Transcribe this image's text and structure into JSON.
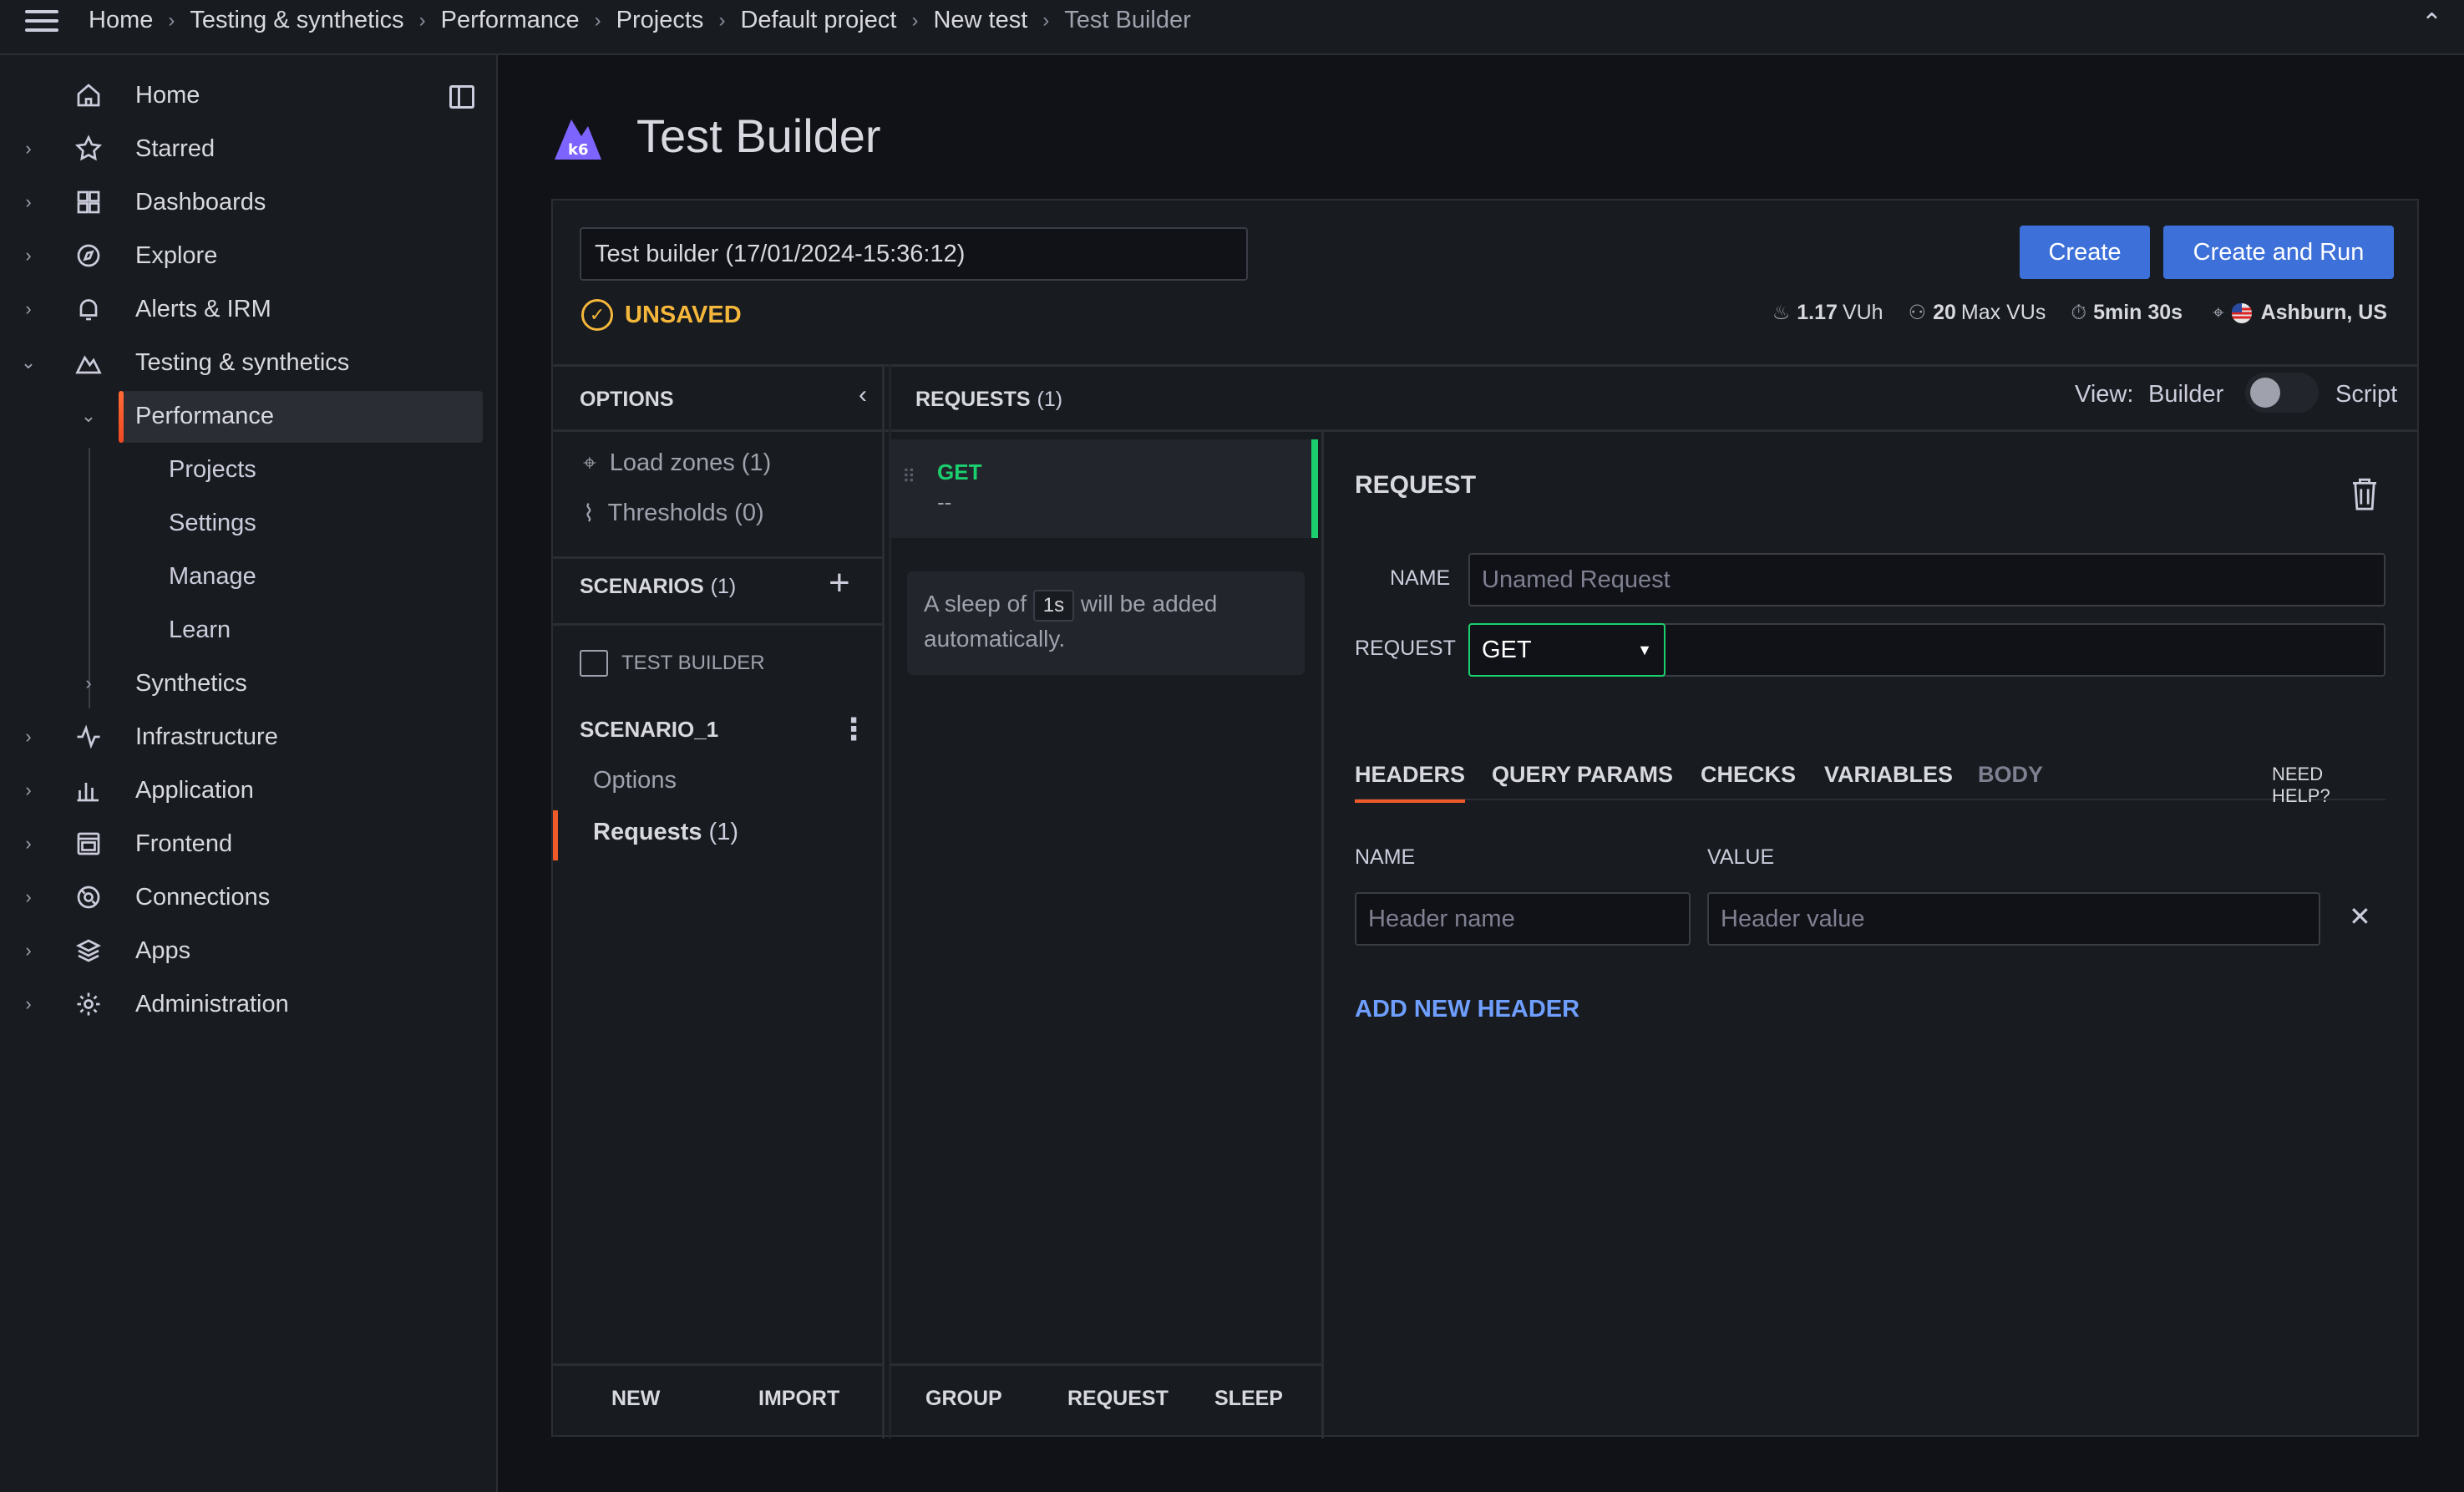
{
  "breadcrumb": [
    "Home",
    "Testing & synthetics",
    "Performance",
    "Projects",
    "Default project",
    "New test",
    "Test Builder"
  ],
  "sidebar": {
    "items": [
      {
        "label": "Home"
      },
      {
        "label": "Starred"
      },
      {
        "label": "Dashboards"
      },
      {
        "label": "Explore"
      },
      {
        "label": "Alerts & IRM"
      },
      {
        "label": "Testing & synthetics"
      },
      {
        "label": "Performance"
      },
      {
        "label": "Projects"
      },
      {
        "label": "Settings"
      },
      {
        "label": "Manage"
      },
      {
        "label": "Learn"
      },
      {
        "label": "Synthetics"
      },
      {
        "label": "Infrastructure"
      },
      {
        "label": "Application"
      },
      {
        "label": "Frontend"
      },
      {
        "label": "Connections"
      },
      {
        "label": "Apps"
      },
      {
        "label": "Administration"
      }
    ]
  },
  "page": {
    "title": "Test Builder",
    "test_name": "Test builder (17/01/2024-15:36:12)",
    "status": "UNSAVED",
    "create_label": "Create",
    "create_run_label": "Create and Run",
    "stats": {
      "vuh_value": "1.17",
      "vuh_unit": "VUh",
      "vus_value": "20",
      "vus_unit": "Max VUs",
      "duration": "5min 30s",
      "location": "Ashburn, US"
    }
  },
  "options_panel": {
    "header": "OPTIONS",
    "load_zones": "Load zones (1)",
    "thresholds": "Thresholds (0)",
    "scenarios_header": "SCENARIOS",
    "scenarios_count": "(1)",
    "test_builder_label": "TEST BUILDER",
    "scenario_name": "SCENARIO_1",
    "scenario_options": "Options",
    "scenario_requests": "Requests",
    "scenario_requests_count": "(1)",
    "new_label": "NEW",
    "import_label": "IMPORT"
  },
  "requests_panel": {
    "header": "REQUESTS",
    "count": "(1)",
    "method": "GET",
    "url": "--",
    "sleep_prefix": "A sleep of",
    "sleep_value": "1s",
    "sleep_suffix": "will be added automatically.",
    "group_label": "GROUP",
    "request_label": "REQUEST",
    "sleep_label": "SLEEP"
  },
  "view": {
    "label": "View:",
    "builder": "Builder",
    "script": "Script"
  },
  "request_panel": {
    "title": "REQUEST",
    "name_label": "NAME",
    "name_placeholder": "Unamed Request",
    "request_label": "REQUEST",
    "method": "GET",
    "tabs": [
      "HEADERS",
      "QUERY PARAMS",
      "CHECKS",
      "VARIABLES",
      "BODY"
    ],
    "need_help": "NEED HELP?",
    "header_name_col": "NAME",
    "header_value_col": "VALUE",
    "header_name_placeholder": "Header name",
    "header_value_placeholder": "Header value",
    "add_header": "ADD NEW HEADER"
  },
  "colors": {
    "accent_blue": "#3d71d9",
    "unsaved": "#f5b73b",
    "get_green": "#1bcf6e",
    "active_orange": "#f05a28"
  }
}
